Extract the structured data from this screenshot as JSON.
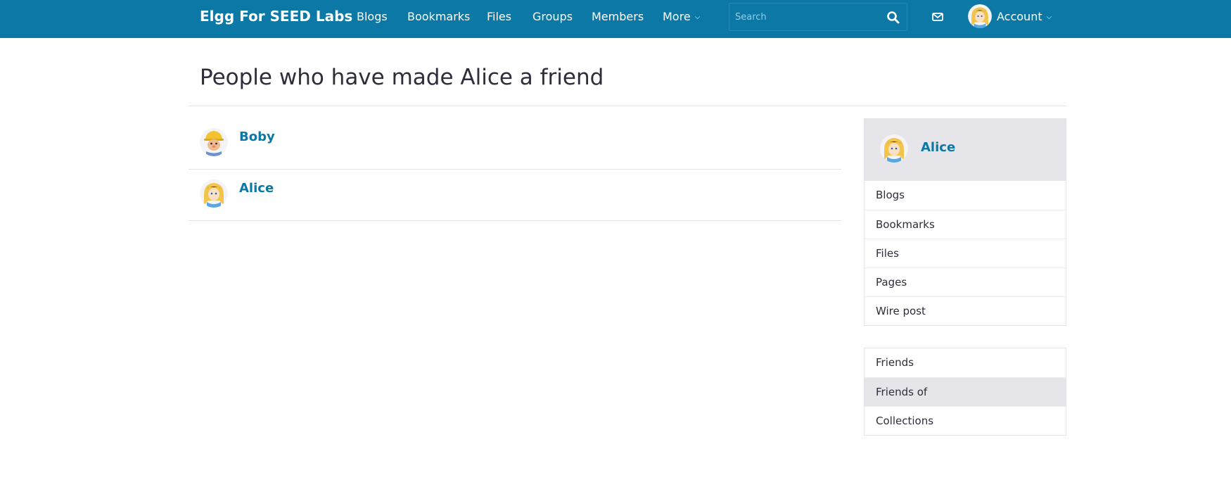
{
  "topbar": {
    "brand": "Elgg For SEED Labs",
    "nav": [
      {
        "label": "Blogs"
      },
      {
        "label": "Bookmarks"
      },
      {
        "label": "Files"
      },
      {
        "label": "Groups"
      },
      {
        "label": "Members"
      },
      {
        "label": "More"
      }
    ],
    "search_placeholder": "Search",
    "account_label": "Account",
    "icons": {
      "search": "search-icon",
      "mail": "envelope-icon",
      "caret": "chevron-down-icon"
    },
    "bar_color": "#0b78a6"
  },
  "page": {
    "title": "People who have made Alice a friend"
  },
  "friends_list": [
    {
      "name": "Boby",
      "avatar": "boby-avatar"
    },
    {
      "name": "Alice",
      "avatar": "alice-avatar"
    }
  ],
  "sidebar": {
    "owner_name": "Alice",
    "owner_menu": [
      {
        "label": "Blogs"
      },
      {
        "label": "Bookmarks"
      },
      {
        "label": "Files"
      },
      {
        "label": "Pages"
      },
      {
        "label": "Wire post"
      }
    ],
    "friends_menu": [
      {
        "label": "Friends",
        "selected": false
      },
      {
        "label": "Friends of",
        "selected": true
      },
      {
        "label": "Collections",
        "selected": false
      }
    ]
  },
  "colors": {
    "link": "#0b78a6",
    "text": "#2d2d3c",
    "selected_bg": "#e6e6ea"
  }
}
